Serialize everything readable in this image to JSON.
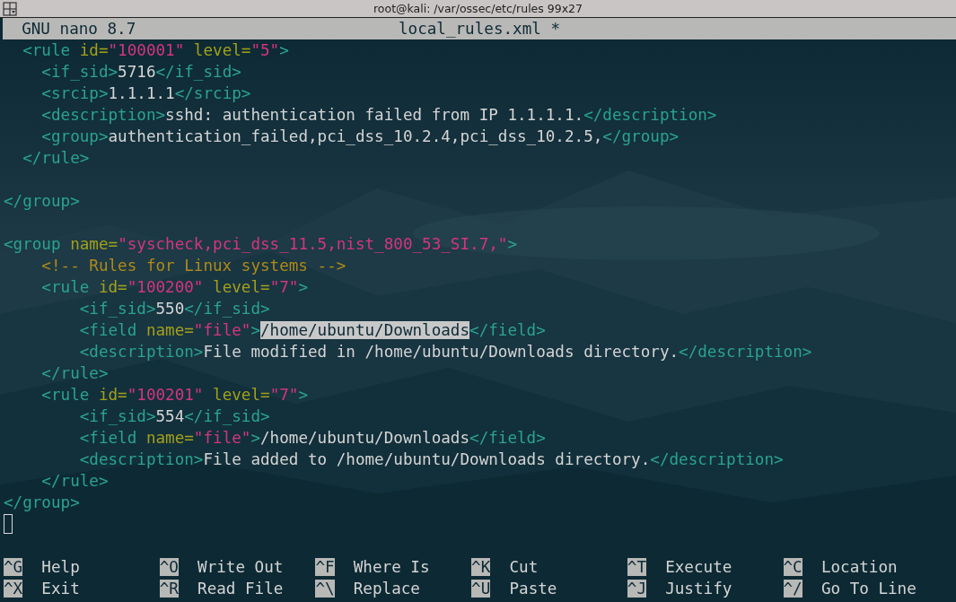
{
  "window": {
    "title": "root@kali: /var/ossec/etc/rules 99x27"
  },
  "nano_header": {
    "version": "GNU nano 8.7",
    "filename": "local_rules.xml *"
  },
  "lines": [
    {
      "kind": "code",
      "tokens": [
        {
          "kind": "tag",
          "text": "  <rule"
        },
        {
          "kind": "attr",
          "text": " id="
        },
        {
          "kind": "value",
          "text": "\"100001\""
        },
        {
          "kind": "attr",
          "text": " level="
        },
        {
          "kind": "value",
          "text": "\"5\""
        },
        {
          "kind": "tag",
          "text": ">"
        }
      ]
    },
    {
      "kind": "code",
      "tokens": [
        {
          "kind": "tag",
          "text": "    <if_sid>"
        },
        {
          "kind": "text",
          "text": "5716"
        },
        {
          "kind": "tag",
          "text": "</if_sid>"
        }
      ]
    },
    {
      "kind": "code",
      "tokens": [
        {
          "kind": "tag",
          "text": "    <srcip>"
        },
        {
          "kind": "text",
          "text": "1.1.1.1"
        },
        {
          "kind": "tag",
          "text": "</srcip>"
        }
      ]
    },
    {
      "kind": "code",
      "tokens": [
        {
          "kind": "tag",
          "text": "    <description>"
        },
        {
          "kind": "text",
          "text": "sshd: authentication failed from IP 1.1.1.1."
        },
        {
          "kind": "tag",
          "text": "</description>"
        }
      ]
    },
    {
      "kind": "code",
      "tokens": [
        {
          "kind": "tag",
          "text": "    <group>"
        },
        {
          "kind": "text",
          "text": "authentication_failed,pci_dss_10.2.4,pci_dss_10.2.5,"
        },
        {
          "kind": "tag",
          "text": "</group>"
        }
      ]
    },
    {
      "kind": "code",
      "tokens": [
        {
          "kind": "tag",
          "text": "  </rule>"
        }
      ]
    },
    {
      "kind": "blank"
    },
    {
      "kind": "code",
      "tokens": [
        {
          "kind": "tag",
          "text": "</group>"
        }
      ]
    },
    {
      "kind": "blank"
    },
    {
      "kind": "code",
      "tokens": [
        {
          "kind": "tag",
          "text": "<group"
        },
        {
          "kind": "attr",
          "text": " name="
        },
        {
          "kind": "value",
          "text": "\"syscheck,pci_dss_11.5,nist_800_53_SI.7,\""
        },
        {
          "kind": "tag",
          "text": ">"
        }
      ]
    },
    {
      "kind": "code",
      "tokens": [
        {
          "kind": "comment",
          "text": "    <!-- Rules for Linux systems -->"
        }
      ]
    },
    {
      "kind": "code",
      "tokens": [
        {
          "kind": "tag",
          "text": "    <rule"
        },
        {
          "kind": "attr",
          "text": " id="
        },
        {
          "kind": "value",
          "text": "\"100200\""
        },
        {
          "kind": "attr",
          "text": " level="
        },
        {
          "kind": "value",
          "text": "\"7\""
        },
        {
          "kind": "tag",
          "text": ">"
        }
      ]
    },
    {
      "kind": "code",
      "tokens": [
        {
          "kind": "tag",
          "text": "        <if_sid>"
        },
        {
          "kind": "text",
          "text": "550"
        },
        {
          "kind": "tag",
          "text": "</if_sid>"
        }
      ]
    },
    {
      "kind": "code",
      "tokens": [
        {
          "kind": "tag",
          "text": "        <field"
        },
        {
          "kind": "attr",
          "text": " name="
        },
        {
          "kind": "value",
          "text": "\"file\""
        },
        {
          "kind": "tag",
          "text": ">"
        },
        {
          "kind": "highlight",
          "text": "/home/ubuntu/Downloads"
        },
        {
          "kind": "tag",
          "text": "</field>"
        }
      ]
    },
    {
      "kind": "code",
      "tokens": [
        {
          "kind": "tag",
          "text": "        <description>"
        },
        {
          "kind": "text",
          "text": "File modified in /home/ubuntu/Downloads directory."
        },
        {
          "kind": "tag",
          "text": "</description>"
        }
      ]
    },
    {
      "kind": "code",
      "tokens": [
        {
          "kind": "tag",
          "text": "    </rule>"
        }
      ]
    },
    {
      "kind": "code",
      "tokens": [
        {
          "kind": "tag",
          "text": "    <rule"
        },
        {
          "kind": "attr",
          "text": " id="
        },
        {
          "kind": "value",
          "text": "\"100201\""
        },
        {
          "kind": "attr",
          "text": " level="
        },
        {
          "kind": "value",
          "text": "\"7\""
        },
        {
          "kind": "tag",
          "text": ">"
        }
      ]
    },
    {
      "kind": "code",
      "tokens": [
        {
          "kind": "tag",
          "text": "        <if_sid>"
        },
        {
          "kind": "text",
          "text": "554"
        },
        {
          "kind": "tag",
          "text": "</if_sid>"
        }
      ]
    },
    {
      "kind": "code",
      "tokens": [
        {
          "kind": "tag",
          "text": "        <field"
        },
        {
          "kind": "attr",
          "text": " name="
        },
        {
          "kind": "value",
          "text": "\"file\""
        },
        {
          "kind": "tag",
          "text": ">"
        },
        {
          "kind": "text",
          "text": "/home/ubuntu/Downloads"
        },
        {
          "kind": "tag",
          "text": "</field>"
        }
      ]
    },
    {
      "kind": "code",
      "tokens": [
        {
          "kind": "tag",
          "text": "        <description>"
        },
        {
          "kind": "text",
          "text": "File added to /home/ubuntu/Downloads directory."
        },
        {
          "kind": "tag",
          "text": "</description>"
        }
      ]
    },
    {
      "kind": "code",
      "tokens": [
        {
          "kind": "tag",
          "text": "    </rule>"
        }
      ]
    },
    {
      "kind": "code",
      "tokens": [
        {
          "kind": "tag",
          "text": "</group>"
        }
      ]
    },
    {
      "kind": "cursor"
    },
    {
      "kind": "blank"
    }
  ],
  "shortcuts": [
    [
      {
        "key": "^G",
        "label": "Help"
      },
      {
        "key": "^O",
        "label": "Write Out"
      },
      {
        "key": "^F",
        "label": "Where Is"
      },
      {
        "key": "^K",
        "label": "Cut"
      },
      {
        "key": "^T",
        "label": "Execute"
      },
      {
        "key": "^C",
        "label": "Location"
      }
    ],
    [
      {
        "key": "^X",
        "label": "Exit"
      },
      {
        "key": "^R",
        "label": "Read File"
      },
      {
        "key": "^\\",
        "label": "Replace"
      },
      {
        "key": "^U",
        "label": "Paste"
      },
      {
        "key": "^J",
        "label": "Justify"
      },
      {
        "key": "^/",
        "label": "Go To Line"
      }
    ]
  ]
}
